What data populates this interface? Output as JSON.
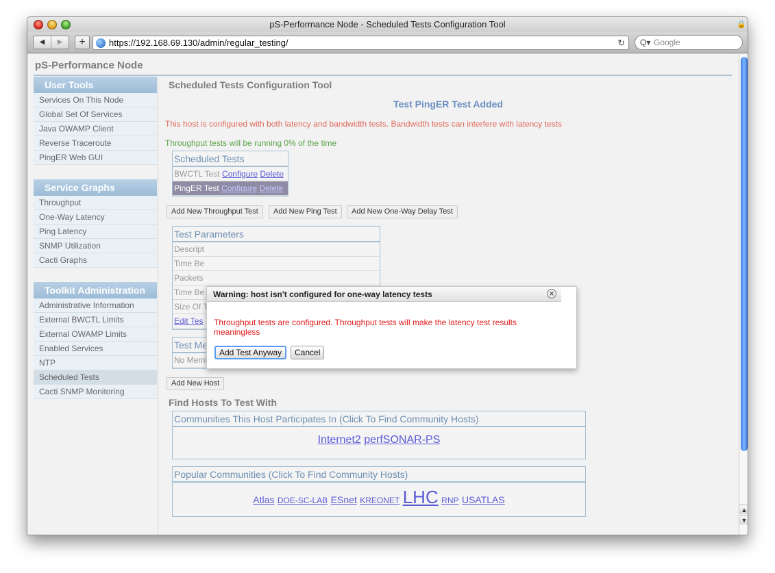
{
  "window": {
    "title": "pS-Performance Node - Scheduled Tests Configuration Tool"
  },
  "toolbar": {
    "back_icon": "◀",
    "forward_icon": "▶",
    "add_icon": "+",
    "url": "https://192.168.69.130/admin/regular_testing/",
    "reload_icon": "↻",
    "search_icon": "Q▾",
    "search_placeholder": "Google"
  },
  "page": {
    "header": "pS-Performance Node",
    "main_title": "Scheduled Tests Configuration Tool",
    "status": "Test PingER Test Added",
    "warning": "This host is configured with both latency and bandwidth tests. Bandwidth tests can interfere with latency tests",
    "info": "Throughput tests will be running 0% of the time"
  },
  "sidebar": {
    "sections": [
      {
        "title": "User Tools",
        "items": [
          "Services On This Node",
          "Global Set Of Services",
          "Java OWAMP Client",
          "Reverse Traceroute",
          "PingER Web GUI"
        ]
      },
      {
        "title": "Service Graphs",
        "items": [
          "Throughput",
          "One-Way Latency",
          "Ping Latency",
          "SNMP Utilization",
          "Cacti Graphs"
        ]
      },
      {
        "title": "Toolkit Administration",
        "items": [
          "Administrative Information",
          "External BWCTL Limits",
          "External OWAMP Limits",
          "Enabled Services",
          "NTP",
          "Scheduled Tests",
          "Cacti SNMP Monitoring"
        ]
      }
    ]
  },
  "scheduled_tests": {
    "title": "Scheduled Tests",
    "rows": [
      {
        "name": "BWCTL Test",
        "configure": "Configure",
        "delete": "Delete"
      },
      {
        "name": "PingER Test",
        "configure": "Configure",
        "delete": "Delete"
      }
    ]
  },
  "buttons": {
    "add_throughput": "Add New Throughput Test",
    "add_ping": "Add New Ping Test",
    "add_owd": "Add New One-Way Delay Test",
    "add_host": "Add New Host"
  },
  "test_parameters": {
    "title": "Test Parameters",
    "rows": [
      "Descript",
      "Time Be",
      "Packets",
      "Time Be",
      "Size Of T"
    ],
    "edit_link": "Edit Tes"
  },
  "test_members": {
    "title": "Test Members",
    "empty": "No Members In Test"
  },
  "find_hosts": {
    "title": "Find Hosts To Test With",
    "participating": {
      "title": "Communities This Host Participates In (Click To Find Community Hosts)",
      "links": [
        "Internet2",
        "perfSONAR-PS"
      ]
    },
    "popular": {
      "title": "Popular Communities (Click To Find Community Hosts)",
      "links": [
        "Atlas",
        "DOE-SC-LAB",
        "ESnet",
        "KREONET",
        "LHC",
        "RNP",
        "USATLAS"
      ]
    }
  },
  "dialog": {
    "title": "Warning: host isn't configured for one-way latency tests",
    "close_icon": "✕",
    "message": "Throughput tests are configured. Throughput tests will make the latency test results meaningless",
    "ok_label": "Add Test Anyway",
    "cancel_label": "Cancel"
  }
}
